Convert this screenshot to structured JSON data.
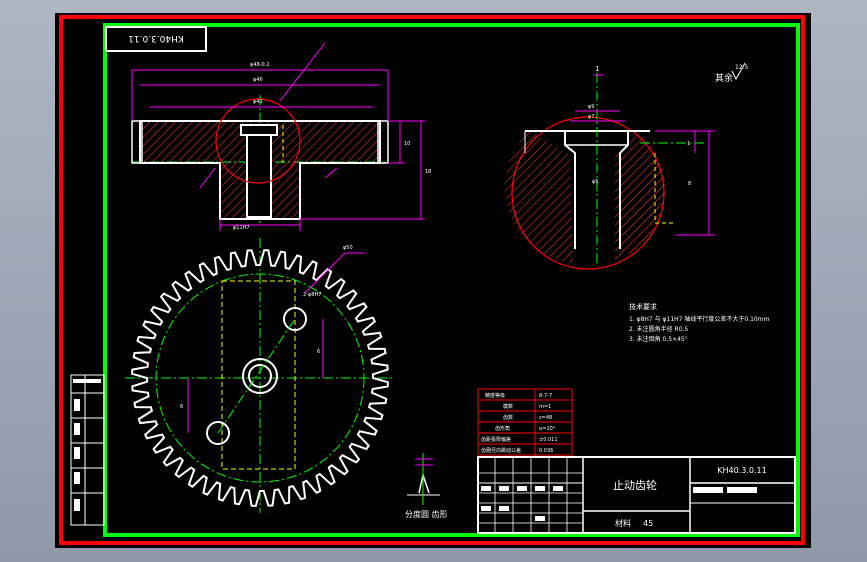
{
  "drawing_number_box": "KH40.3.0.11",
  "title_block": {
    "part_name": "止动齿轮",
    "drawing_number": "KH40.3.0.11",
    "material_label": "材料",
    "material_value": "45"
  },
  "gear_params": {
    "rows": [
      {
        "label": "精度等级",
        "value": "8-7-7"
      },
      {
        "label": "模数",
        "value": "m=1"
      },
      {
        "label": "齿数",
        "value": "z=48"
      },
      {
        "label": "齿形角",
        "value": "α=20°"
      },
      {
        "label": "齿距极限偏差",
        "value": "±0.011"
      },
      {
        "label": "齿圈径向跳动公差",
        "value": "0.036"
      }
    ]
  },
  "tech_requirements": {
    "title": "技术要求",
    "items": [
      "1. φ8H7 与 φ11H7 轴线平行度公差不大于0.10mm",
      "2. 未注圆角半径 R0.5",
      "3. 未注倒角 0.5×45°"
    ]
  },
  "labels": {
    "tooth_profile": "分度圆 齿形",
    "roughness_other": "其余",
    "roughness_value": "12.5",
    "annotation_one": "1",
    "annotation_two": "2"
  },
  "colors": {
    "outer_border": "#ff0000",
    "inner_border": "#00ff00",
    "outline": "#ffffff",
    "dimension": "#ff00ff",
    "hatch": "#ff4040",
    "centerline": "#00ff00",
    "hidden": "#ffff00",
    "table_line": "#ff0000"
  }
}
